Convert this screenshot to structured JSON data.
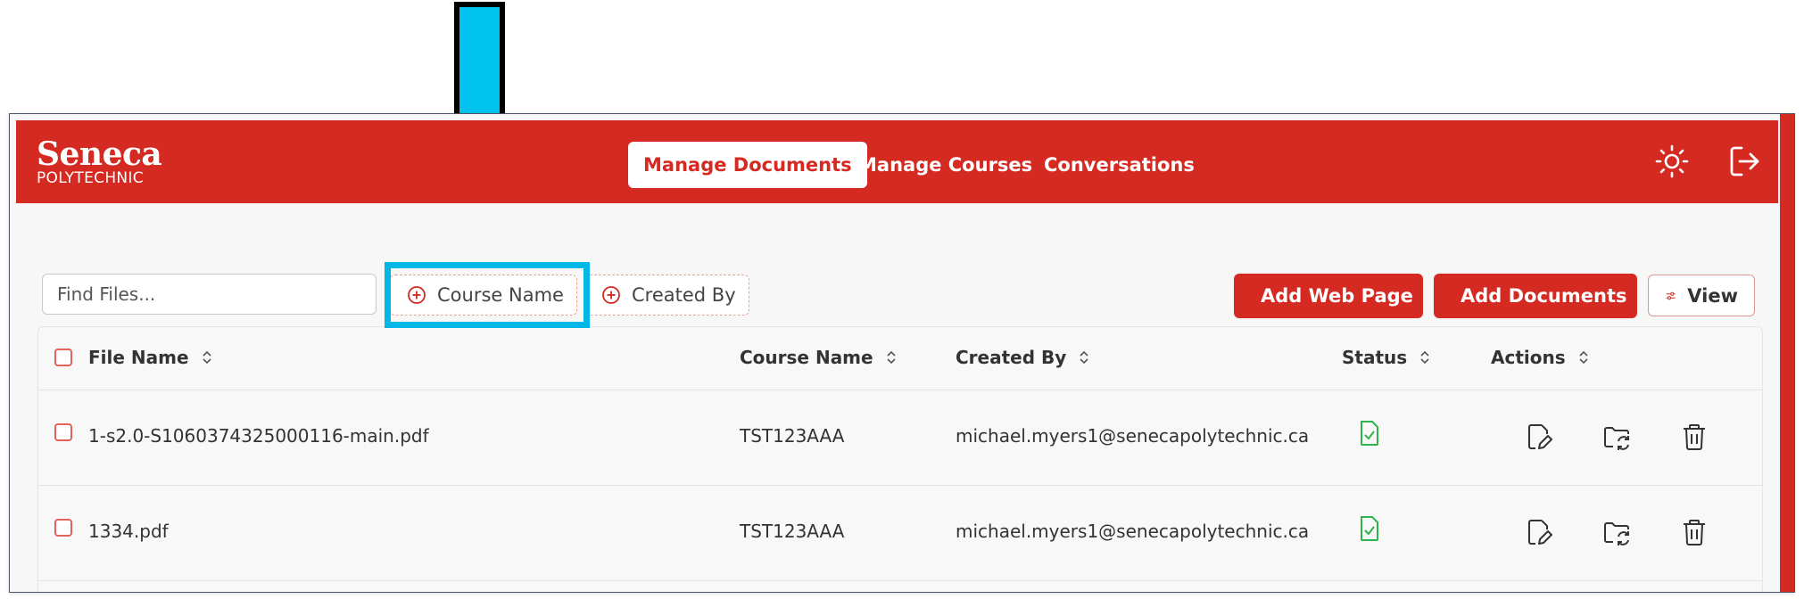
{
  "brand": {
    "line1": "Seneca",
    "line2": "POLYTECHNIC"
  },
  "nav": {
    "items": [
      {
        "label": "Manage Documents",
        "active": true
      },
      {
        "label": "Manage Courses",
        "active": false
      },
      {
        "label": "Conversations",
        "active": false
      }
    ],
    "icons": [
      "sun-icon",
      "logout-icon"
    ]
  },
  "toolbar": {
    "search_placeholder": "Find Files...",
    "filters": [
      {
        "label": "Course Name",
        "icon": "plus-circle-icon"
      },
      {
        "label": "Created By",
        "icon": "plus-circle-icon"
      }
    ],
    "add_web_page_label": "Add Web Page",
    "add_documents_label": "Add Documents",
    "view_label": "View"
  },
  "table": {
    "columns": [
      "File Name",
      "Course Name",
      "Created By",
      "Status",
      "Actions"
    ],
    "rows": [
      {
        "file_name": "1-s2.0-S1060374325000116-main.pdf",
        "course_name": "TST123AAA",
        "created_by": "michael.myers1@senecapolytechnic.ca",
        "status": "file-check-icon"
      },
      {
        "file_name": "1334.pdf",
        "course_name": "TST123AAA",
        "created_by": "michael.myers1@senecapolytechnic.ca",
        "status": "file-check-icon"
      }
    ]
  },
  "colors": {
    "brand_red": "#d52a22",
    "highlight_cyan": "#00b7e6",
    "status_green": "#2fb34b"
  }
}
